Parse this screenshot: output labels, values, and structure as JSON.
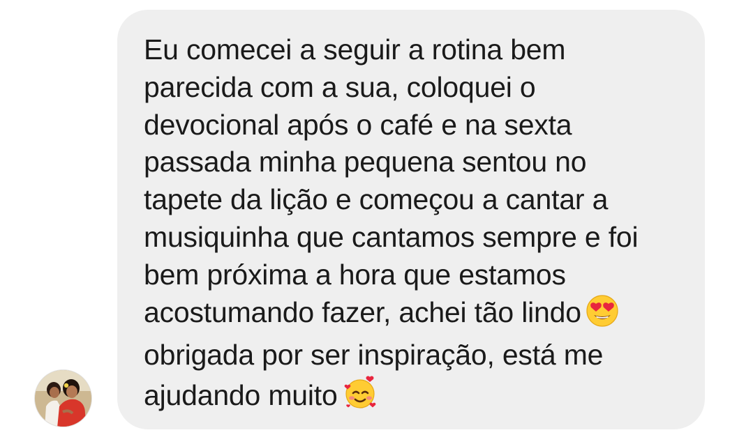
{
  "message": {
    "lines": [
      "Eu comecei a seguir a rotina bem",
      "parecida com a sua, coloquei o",
      "devocional após o café e na sexta",
      "passada minha pequena sentou no",
      "tapete da lição e começou a cantar a",
      "musiquinha que cantamos sempre e foi",
      "bem próxima a hora que estamos",
      "acostumando fazer, achei tão lindo",
      "obrigada por ser inspiração, está me",
      "ajudando muito"
    ],
    "emoji_1": "smiling-face-with-heart-eyes",
    "emoji_2": "smiling-face-with-hearts"
  },
  "colors": {
    "bubble_background": "#efefef",
    "text": "#1a1a1a"
  },
  "sender": {
    "avatar_icon": "profile-photo-avatar"
  }
}
